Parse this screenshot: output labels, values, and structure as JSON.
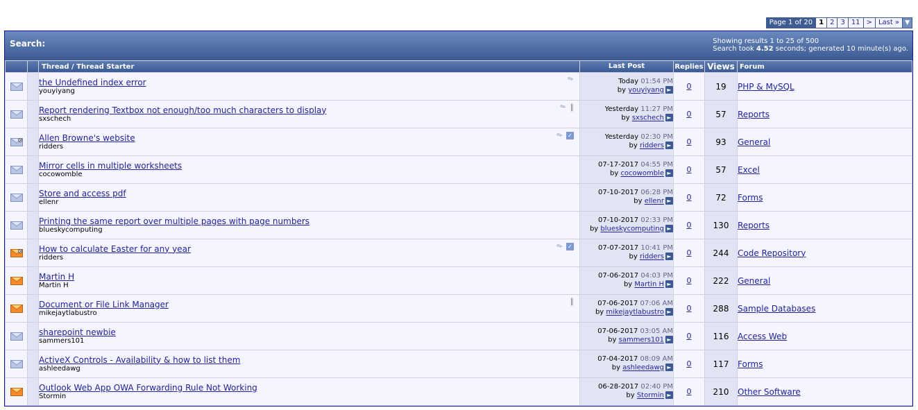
{
  "pagination": {
    "label": "Page 1 of 20",
    "current": "1",
    "pages": [
      "2",
      "3",
      "11"
    ],
    "next": ">",
    "last": "Last »",
    "menu_glyph": "▼"
  },
  "search": {
    "title": "Search:",
    "results_line": "Showing results 1 to 25 of 500",
    "timing_prefix": "Search took ",
    "timing_value": "4.52",
    "timing_suffix": " seconds; generated 10 minute(s) ago."
  },
  "columns": {
    "thread": "Thread / Thread Starter",
    "last_post": "Last Post",
    "replies": "Replies",
    "views": "Views",
    "forum": "Forum"
  },
  "threads": [
    {
      "title": "the Undefined index error",
      "starter": "youyiyang",
      "date": "Today",
      "time": "01:54 PM",
      "by_prefix": "by ",
      "last_by": "youyiyang",
      "replies": "0",
      "views": "19",
      "forum": "PHP & MySQL",
      "icon": "envelope-blue",
      "flags": [
        "tag-icon"
      ]
    },
    {
      "title": "Report rendering Textbox not enough/too much characters to display",
      "starter": "sxschech",
      "date": "Yesterday",
      "time": "11:27 PM",
      "by_prefix": "by ",
      "last_by": "sxschech",
      "replies": "0",
      "views": "57",
      "forum": "Reports",
      "icon": "envelope-blue",
      "flags": [
        "tag-icon",
        "paperclip-icon"
      ]
    },
    {
      "title": "Allen Browne's website",
      "starter": "ridders",
      "date": "Yesterday",
      "time": "02:30 PM",
      "by_prefix": "by ",
      "last_by": "ridders",
      "replies": "0",
      "views": "93",
      "forum": "General",
      "icon": "envelope-blue-dot",
      "flags": [
        "tag-icon",
        "check-icon"
      ]
    },
    {
      "title": "Mirror cells in multiple worksheets",
      "starter": "cocowomble",
      "date": "07-17-2017",
      "time": "04:55 PM",
      "by_prefix": "by ",
      "last_by": "cocowomble",
      "replies": "0",
      "views": "57",
      "forum": "Excel",
      "icon": "envelope-blue",
      "flags": []
    },
    {
      "title": "Store and access pdf",
      "starter": "ellenr",
      "date": "07-10-2017",
      "time": "06:28 PM",
      "by_prefix": "by ",
      "last_by": "ellenr",
      "replies": "0",
      "views": "72",
      "forum": "Forms",
      "icon": "envelope-blue",
      "flags": []
    },
    {
      "title": "Printing the same report over multiple pages with page numbers",
      "starter": "blueskycomputing",
      "date": "07-10-2017",
      "time": "02:33 PM",
      "by_prefix": "by ",
      "last_by": "blueskycomputing",
      "replies": "0",
      "views": "130",
      "forum": "Reports",
      "icon": "envelope-blue",
      "flags": []
    },
    {
      "title": "How to calculate Easter for any year",
      "starter": "ridders",
      "date": "07-07-2017",
      "time": "10:41 PM",
      "by_prefix": "by ",
      "last_by": "ridders",
      "replies": "0",
      "views": "244",
      "forum": "Code Repository",
      "icon": "envelope-orange-dot",
      "flags": [
        "tag-icon",
        "check-icon"
      ]
    },
    {
      "title": "Martin H",
      "starter": "Martin H",
      "date": "07-06-2017",
      "time": "04:03 PM",
      "by_prefix": "by ",
      "last_by": "Martin H",
      "replies": "0",
      "views": "222",
      "forum": "General",
      "icon": "envelope-orange",
      "flags": []
    },
    {
      "title": "Document or File Link Manager",
      "starter": "mikejaytlabustro",
      "date": "07-06-2017",
      "time": "07:06 AM",
      "by_prefix": "by ",
      "last_by": "mikejaytlabustro",
      "replies": "0",
      "views": "288",
      "forum": "Sample Databases",
      "icon": "envelope-orange",
      "flags": [
        "paperclip-icon"
      ]
    },
    {
      "title": "sharepoint newbie",
      "starter": "sammers101",
      "date": "07-06-2017",
      "time": "03:05 AM",
      "by_prefix": "by ",
      "last_by": "sammers101",
      "replies": "0",
      "views": "116",
      "forum": "Access Web",
      "icon": "envelope-blue",
      "flags": []
    },
    {
      "title": "ActiveX Controls - Availability & how to list them",
      "starter": "ashleedawg",
      "date": "07-04-2017",
      "time": "08:09 AM",
      "by_prefix": "by ",
      "last_by": "ashleedawg",
      "replies": "0",
      "views": "117",
      "forum": "Forms",
      "icon": "envelope-blue",
      "flags": []
    },
    {
      "title": "Outlook Web App OWA Forwarding Rule Not Working",
      "starter": "Stormin",
      "date": "06-28-2017",
      "time": "02:40 PM",
      "by_prefix": "by ",
      "last_by": "Stormin",
      "replies": "0",
      "views": "210",
      "forum": "Other Software",
      "icon": "envelope-orange",
      "flags": []
    }
  ],
  "colors": {
    "header_bg": "#3b5a93",
    "alt1": "#f5f5ff",
    "alt2": "#e1e4f2",
    "link": "#22229c",
    "border": "#0b198c"
  }
}
